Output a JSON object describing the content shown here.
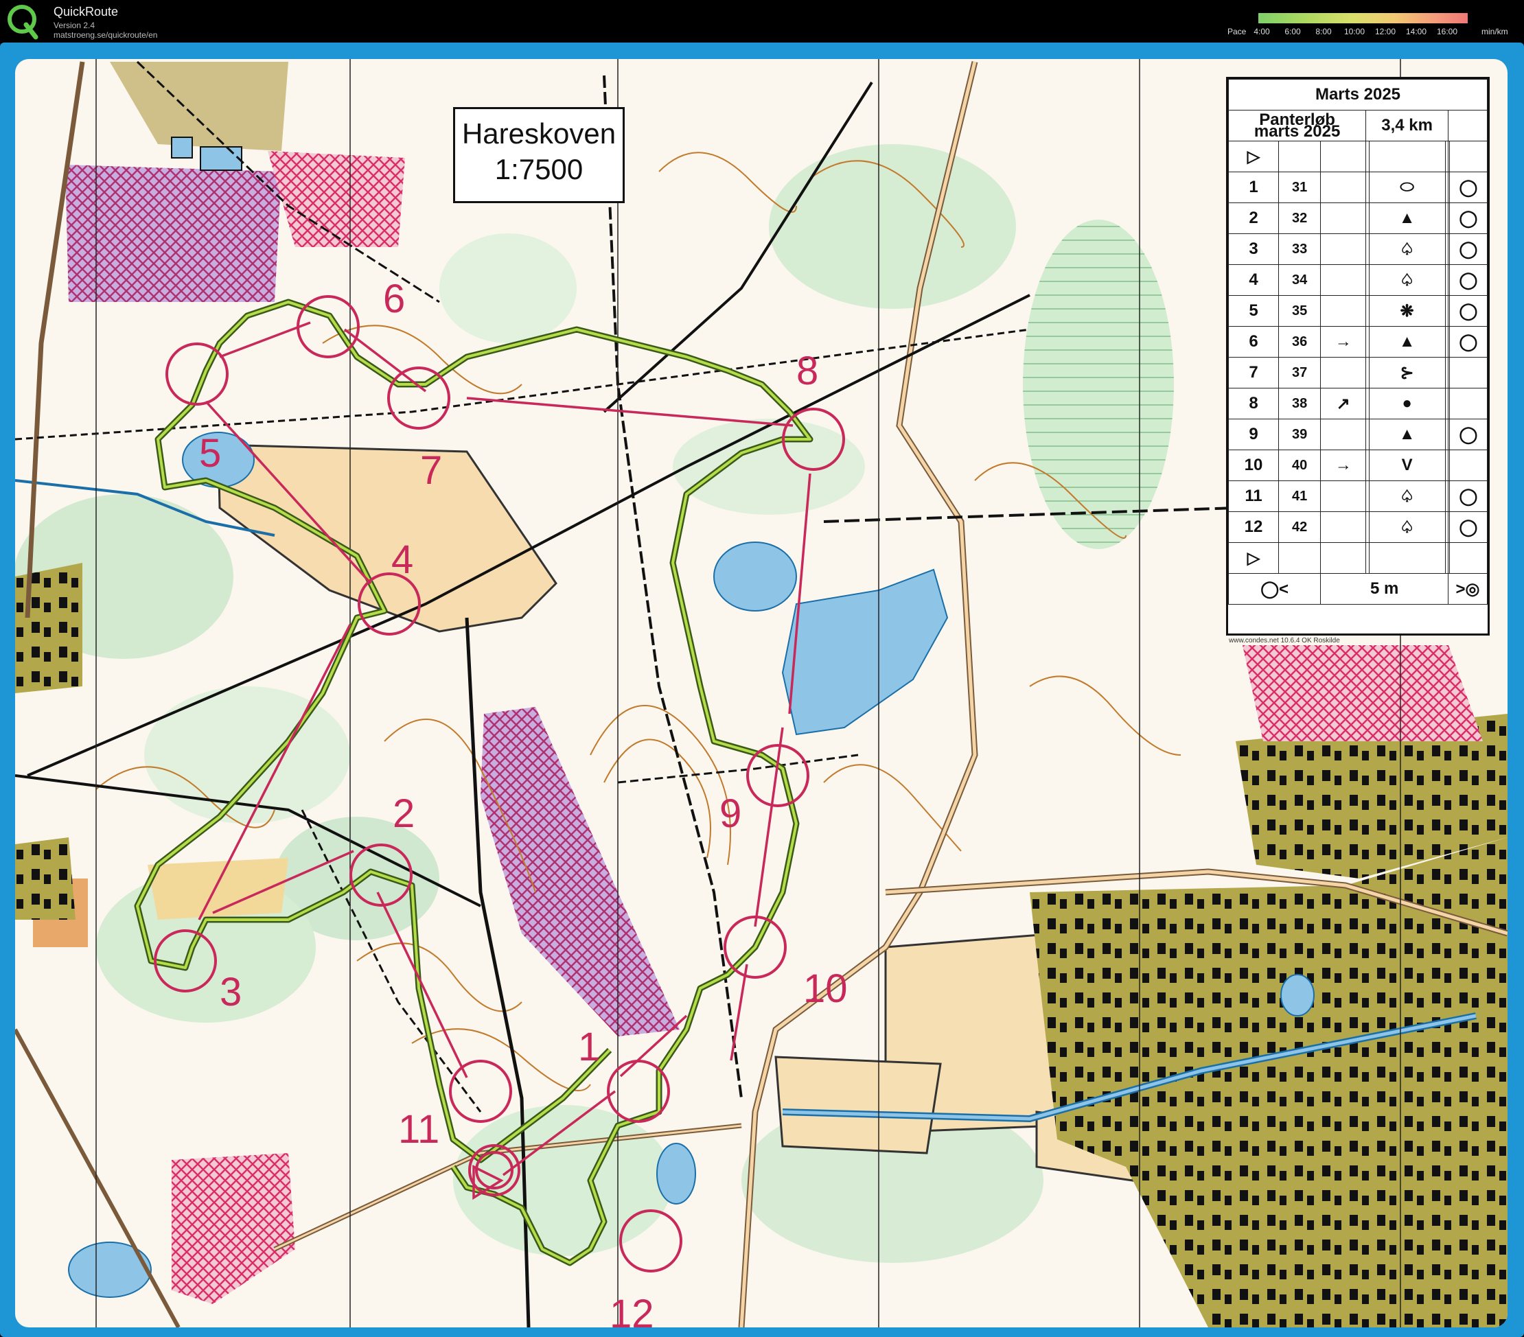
{
  "app": {
    "title": "QuickRoute",
    "version": "Version 2.4",
    "url": "matstroeng.se/quickroute/en"
  },
  "pace_legend": {
    "label": "Pace",
    "ticks": [
      "4:00",
      "6:00",
      "8:00",
      "10:00",
      "12:00",
      "14:00",
      "16:00"
    ],
    "unit": "min/km",
    "colors": [
      "#7fd06a",
      "#d9e06a",
      "#f2c873",
      "#f07878"
    ]
  },
  "map": {
    "name": "Hareskoven",
    "scale": "1:7500",
    "frame_color": "#1e96d6",
    "course_color": "#c8285a",
    "route_color": "#7cc03a"
  },
  "description": {
    "title": "Marts 2025",
    "event_line1": "Panterløb",
    "event_line2": "marts 2025",
    "length": "3,4 km",
    "start_symbol": "▷",
    "controls": [
      {
        "n": "1",
        "code": "31",
        "dir": "",
        "feature": "⬭",
        "loc": "◯"
      },
      {
        "n": "2",
        "code": "32",
        "dir": "",
        "feature": "▲",
        "loc": "◯"
      },
      {
        "n": "3",
        "code": "33",
        "dir": "",
        "feature": "♤",
        "loc": "◯"
      },
      {
        "n": "4",
        "code": "34",
        "dir": "",
        "feature": "♤",
        "loc": "◯"
      },
      {
        "n": "5",
        "code": "35",
        "dir": "",
        "feature": "❋",
        "loc": "◯"
      },
      {
        "n": "6",
        "code": "36",
        "dir": "→",
        "feature": "▲",
        "loc": "◯"
      },
      {
        "n": "7",
        "code": "37",
        "dir": "",
        "feature": "⊱",
        "loc": ""
      },
      {
        "n": "8",
        "code": "38",
        "dir": "↗",
        "feature": "●",
        "loc": ""
      },
      {
        "n": "9",
        "code": "39",
        "dir": "",
        "feature": "▲",
        "loc": "◯"
      },
      {
        "n": "10",
        "code": "40",
        "dir": "→",
        "feature": "V",
        "loc": ""
      },
      {
        "n": "11",
        "code": "41",
        "dir": "",
        "feature": "♤",
        "loc": "◯"
      },
      {
        "n": "12",
        "code": "42",
        "dir": "",
        "feature": "♤",
        "loc": "◯"
      }
    ],
    "finish_symbol": "▷",
    "finish_left": "◯<",
    "finish_distance": "5 m",
    "finish_right": ">◎",
    "credit": "www.condes.net 10.6.4 OK Roskilde"
  },
  "course": {
    "labels": [
      "1",
      "2",
      "3",
      "4",
      "5",
      "6",
      "7",
      "8",
      "9",
      "10",
      "11",
      "12"
    ]
  }
}
